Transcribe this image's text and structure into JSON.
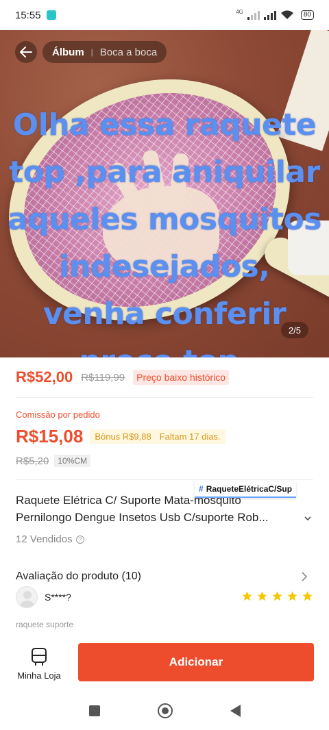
{
  "status_bar": {
    "time": "15:55",
    "network": "4G",
    "battery": "80"
  },
  "gallery": {
    "tabs": [
      "Álbum",
      "Boca a boca"
    ],
    "overlay_text": "Olha essa raquete top ,para aniquilar aqueles mosquitos indesejados, venha conferir preço top.",
    "counter": "2/5"
  },
  "price": {
    "current": "R$52,00",
    "original": "R$119,99",
    "tag": "Preço baixo histórico"
  },
  "commission": {
    "label": "Comissão por pedido",
    "value": "R$15,08",
    "bonus": "Bônus R$9,88",
    "deadline": "Faltam 17 dias.",
    "old_value": "R$5,20",
    "rate_tag": "10%CM"
  },
  "product": {
    "hashtag": "RaqueteElétricaC/Sup",
    "title_line1": "Raquete Elétrica C/ Suporte Mata-mosquito",
    "title_line2": "Pernilongo Dengue Insetos Usb C/suporte Rob...",
    "sold": "12 Vendidos"
  },
  "reviews": {
    "title": "Avaliação do produto (10)",
    "reviewer": "S****?",
    "rating": 5,
    "snippet": "raquete suporte"
  },
  "bottom": {
    "store_label": "Minha Loja",
    "add_label": "Adicionar"
  },
  "colors": {
    "accent": "#ee4d2d",
    "star": "#f6c700",
    "overlay_text": "#5b8ff0"
  }
}
